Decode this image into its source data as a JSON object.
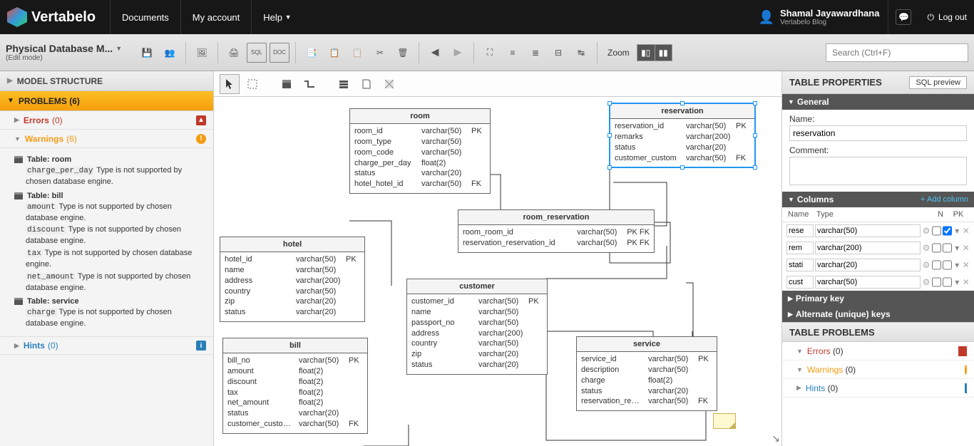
{
  "brand": "Vertabelo",
  "topnav": {
    "documents": "Documents",
    "myaccount": "My account",
    "help": "Help"
  },
  "user": {
    "name": "Shamal Jayawardhana",
    "blog": "Vertabelo Blog",
    "logout": "Log out"
  },
  "toolbar": {
    "title": "Physical Database M...",
    "mode": "(Edit mode)",
    "zoom": "Zoom",
    "search_ph": "Search (Ctrl+F)"
  },
  "left": {
    "structure": "MODEL STRUCTURE",
    "problems": "PROBLEMS (6)",
    "errors": "Errors",
    "errors_n": "(0)",
    "warnings": "Warnings",
    "warnings_n": "(6)",
    "hints": "Hints",
    "hints_n": "(0)",
    "w_room": "Table: room",
    "w_room_1a": "charge_per_day",
    "w_room_1b": "Type is not supported by chosen database engine.",
    "w_bill": "Table: bill",
    "w_bill_1a": "amount",
    "w_bill_1b": "Type is not supported by chosen database engine.",
    "w_bill_2a": "discount",
    "w_bill_2b": "Type is not supported by chosen database engine.",
    "w_bill_3a": "tax",
    "w_bill_3b": "Type is not supported by chosen database engine.",
    "w_bill_4a": "net_amount",
    "w_bill_4b": "Type is not supported by chosen database engine.",
    "w_service": "Table: service",
    "w_service_1a": "charge",
    "w_service_1b": "Type is not supported by chosen database engine."
  },
  "tables": {
    "room": {
      "title": "room",
      "cols": [
        [
          "room_id",
          "varchar(50)",
          "PK"
        ],
        [
          "room_type",
          "varchar(50)",
          ""
        ],
        [
          "room_code",
          "varchar(50)",
          ""
        ],
        [
          "charge_per_day",
          "float(2)",
          ""
        ],
        [
          "status",
          "varchar(20)",
          ""
        ],
        [
          "hotel_hotel_id",
          "varchar(50)",
          "FK"
        ]
      ]
    },
    "reservation": {
      "title": "reservation",
      "cols": [
        [
          "reservation_id",
          "varchar(50)",
          "PK"
        ],
        [
          "remarks",
          "varchar(200)",
          ""
        ],
        [
          "status",
          "varchar(20)",
          ""
        ],
        [
          "customer_custom",
          "varchar(50)",
          "FK"
        ]
      ]
    },
    "room_reservation": {
      "title": "room_reservation",
      "cols": [
        [
          "room_room_id",
          "varchar(50)",
          "PK FK"
        ],
        [
          "reservation_reservation_id",
          "varchar(50)",
          "PK FK"
        ]
      ]
    },
    "hotel": {
      "title": "hotel",
      "cols": [
        [
          "hotel_id",
          "varchar(50)",
          "PK"
        ],
        [
          "name",
          "varchar(50)",
          ""
        ],
        [
          "address",
          "varchar(200)",
          ""
        ],
        [
          "country",
          "varchar(50)",
          ""
        ],
        [
          "zip",
          "varchar(20)",
          ""
        ],
        [
          "status",
          "varchar(20)",
          ""
        ]
      ]
    },
    "customer": {
      "title": "customer",
      "cols": [
        [
          "customer_id",
          "varchar(50)",
          "PK"
        ],
        [
          "name",
          "varchar(50)",
          ""
        ],
        [
          "passport_no",
          "varchar(50)",
          ""
        ],
        [
          "address",
          "varchar(200)",
          ""
        ],
        [
          "country",
          "varchar(50)",
          ""
        ],
        [
          "zip",
          "varchar(20)",
          ""
        ],
        [
          "status",
          "varchar(20)",
          ""
        ]
      ]
    },
    "bill": {
      "title": "bill",
      "cols": [
        [
          "bill_no",
          "varchar(50)",
          "PK"
        ],
        [
          "amount",
          "float(2)",
          ""
        ],
        [
          "discount",
          "float(2)",
          ""
        ],
        [
          "tax",
          "float(2)",
          ""
        ],
        [
          "net_amount",
          "float(2)",
          ""
        ],
        [
          "status",
          "varchar(20)",
          ""
        ],
        [
          "customer_customer",
          "varchar(50)",
          "FK"
        ]
      ]
    },
    "service": {
      "title": "service",
      "cols": [
        [
          "service_id",
          "varchar(50)",
          "PK"
        ],
        [
          "description",
          "varchar(50)",
          ""
        ],
        [
          "charge",
          "float(2)",
          ""
        ],
        [
          "status",
          "varchar(20)",
          ""
        ],
        [
          "reservation_reserva",
          "varchar(50)",
          "FK"
        ]
      ]
    }
  },
  "right": {
    "title": "TABLE PROPERTIES",
    "preview": "SQL preview",
    "general": "General",
    "name_lbl": "Name:",
    "name_val": "reservation",
    "comment_lbl": "Comment:",
    "columns": "Columns",
    "add_col": "+ Add column",
    "ch_name": "Name",
    "ch_type": "Type",
    "ch_n": "N",
    "ch_pk": "PK",
    "rows": [
      {
        "n": "rese",
        "t": "varchar(50)",
        "nn": false,
        "pk": true
      },
      {
        "n": "rem",
        "t": "varchar(200)",
        "nn": false,
        "pk": false
      },
      {
        "n": "stati",
        "t": "varchar(20)",
        "nn": false,
        "pk": false
      },
      {
        "n": "cust",
        "t": "varchar(50)",
        "nn": false,
        "pk": false
      }
    ],
    "pk": "Primary key",
    "ak": "Alternate (unique) keys",
    "tprob": "TABLE PROBLEMS",
    "tp_err": "Errors",
    "tp_err_n": "(0)",
    "tp_warn": "Warnings",
    "tp_warn_n": "(0)",
    "tp_hint": "Hints",
    "tp_hint_n": "(0)"
  }
}
